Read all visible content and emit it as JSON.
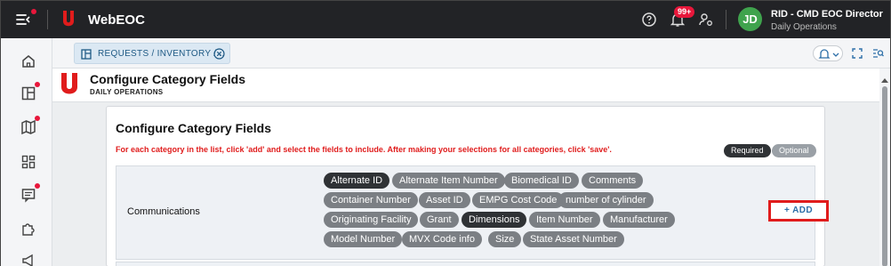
{
  "app": {
    "name": "WebEOC"
  },
  "topbar": {
    "notification_count": "99+",
    "avatar_initials": "JD",
    "user_name": "RID - CMD EOC Director",
    "incident": "Daily Operations"
  },
  "tabs": [
    {
      "label": "REQUESTS / INVENTORY /..."
    }
  ],
  "page_header": {
    "title": "Configure Category Fields",
    "subtitle": "DAILY OPERATIONS"
  },
  "card": {
    "title": "Configure Category Fields",
    "instructions": "For each category in the list, click 'add' and select the fields to include. After making your selections for all categories, click 'save'.",
    "legend": {
      "required": "Required",
      "optional": "Optional"
    },
    "rows": [
      {
        "category": "Communications",
        "add_label": "+ ADD",
        "fields": [
          {
            "label": "Alternate ID",
            "status": "required"
          },
          {
            "label": "Alternate Item Number",
            "status": "optional"
          },
          {
            "label": "Biomedical ID",
            "status": "optional"
          },
          {
            "label": "Comments",
            "status": "optional"
          },
          {
            "label": "Container Number",
            "status": "optional"
          },
          {
            "label": "Asset ID",
            "status": "optional"
          },
          {
            "label": "EMPG Cost Code",
            "status": "optional"
          },
          {
            "label": "number of cylinder",
            "status": "optional"
          },
          {
            "label": "Originating Facility",
            "status": "optional"
          },
          {
            "label": "Grant",
            "status": "optional"
          },
          {
            "label": "Dimensions",
            "status": "required"
          },
          {
            "label": "Item Number",
            "status": "optional"
          },
          {
            "label": "Manufacturer",
            "status": "optional"
          },
          {
            "label": "Model Number",
            "status": "optional"
          },
          {
            "label": "MVX Code info",
            "status": "optional"
          },
          {
            "label": "Size",
            "status": "optional"
          },
          {
            "label": "State Asset Number",
            "status": "optional"
          }
        ]
      }
    ]
  },
  "colors": {
    "brand_red": "#e01c1c",
    "topbar_bg": "#222326",
    "chip_required": "#2f3235",
    "chip_optional": "#7b7f84",
    "accent_blue": "#2d6fa8",
    "avatar_green": "#3fa34d"
  }
}
